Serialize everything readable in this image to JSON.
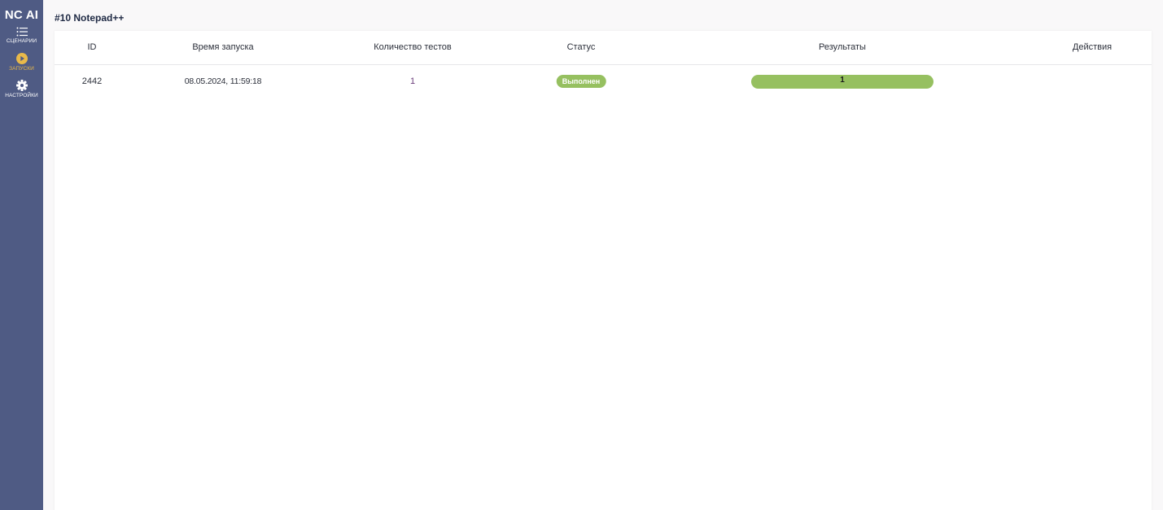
{
  "app": {
    "brand": "NC AI"
  },
  "sidebar": {
    "items": [
      {
        "label": "СЦЕНАРИИ",
        "icon": "list-icon",
        "active": false
      },
      {
        "label": "ЗАПУСКИ",
        "icon": "play-circle-icon",
        "active": true
      },
      {
        "label": "НАСТРОЙКИ",
        "icon": "gear-icon",
        "active": false
      }
    ]
  },
  "page": {
    "title": "#10 Notepad++"
  },
  "table": {
    "columns": [
      "ID",
      "Время запуска",
      "Количество тестов",
      "Статус",
      "Результаты",
      "Действия"
    ],
    "rows": [
      {
        "id": "2442",
        "started": "08.05.2024, 11:59:18",
        "tests": "1",
        "status": "Выполнен",
        "results": {
          "passed": "1",
          "passed_fraction": 1.0
        },
        "actions": ""
      }
    ]
  },
  "colors": {
    "sidebar_bg": "#4f5b84",
    "active_accent": "#e8b94a",
    "success": "#96c060"
  }
}
